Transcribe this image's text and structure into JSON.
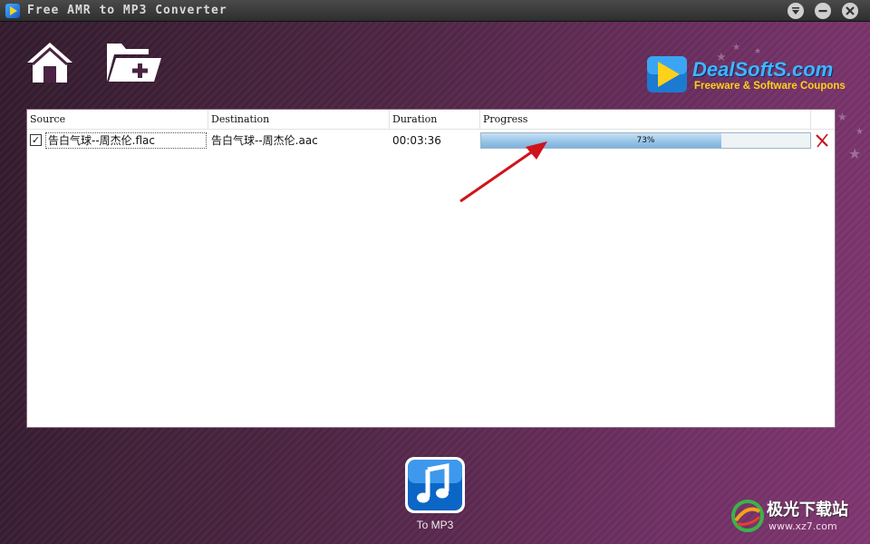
{
  "window": {
    "title": "Free AMR to MP3 Converter",
    "controls": [
      "dropdown-icon",
      "minimize-icon",
      "close-icon"
    ]
  },
  "toolbar": {
    "home_icon": "home-icon",
    "add_folder_icon": "add-folder-icon"
  },
  "brand": {
    "name": "DealSoftS.com",
    "tagline": "Freeware & Software Coupons",
    "accent": "#3fb6ff",
    "tag_color": "#ffd11a"
  },
  "filelist": {
    "columns": [
      "Source",
      "Destination",
      "Duration",
      "Progress"
    ],
    "rows": [
      {
        "checked": true,
        "source": "告白气球--周杰伦.flac",
        "destination": "告白气球--周杰伦.aac",
        "duration": "00:03:36",
        "progress_percent": 73,
        "progress_text": "73%"
      }
    ]
  },
  "convert_button": {
    "label": "To MP3",
    "icon": "music-note-icon"
  },
  "watermark": {
    "text": "极光下载站",
    "url": "www.xz7.com"
  }
}
